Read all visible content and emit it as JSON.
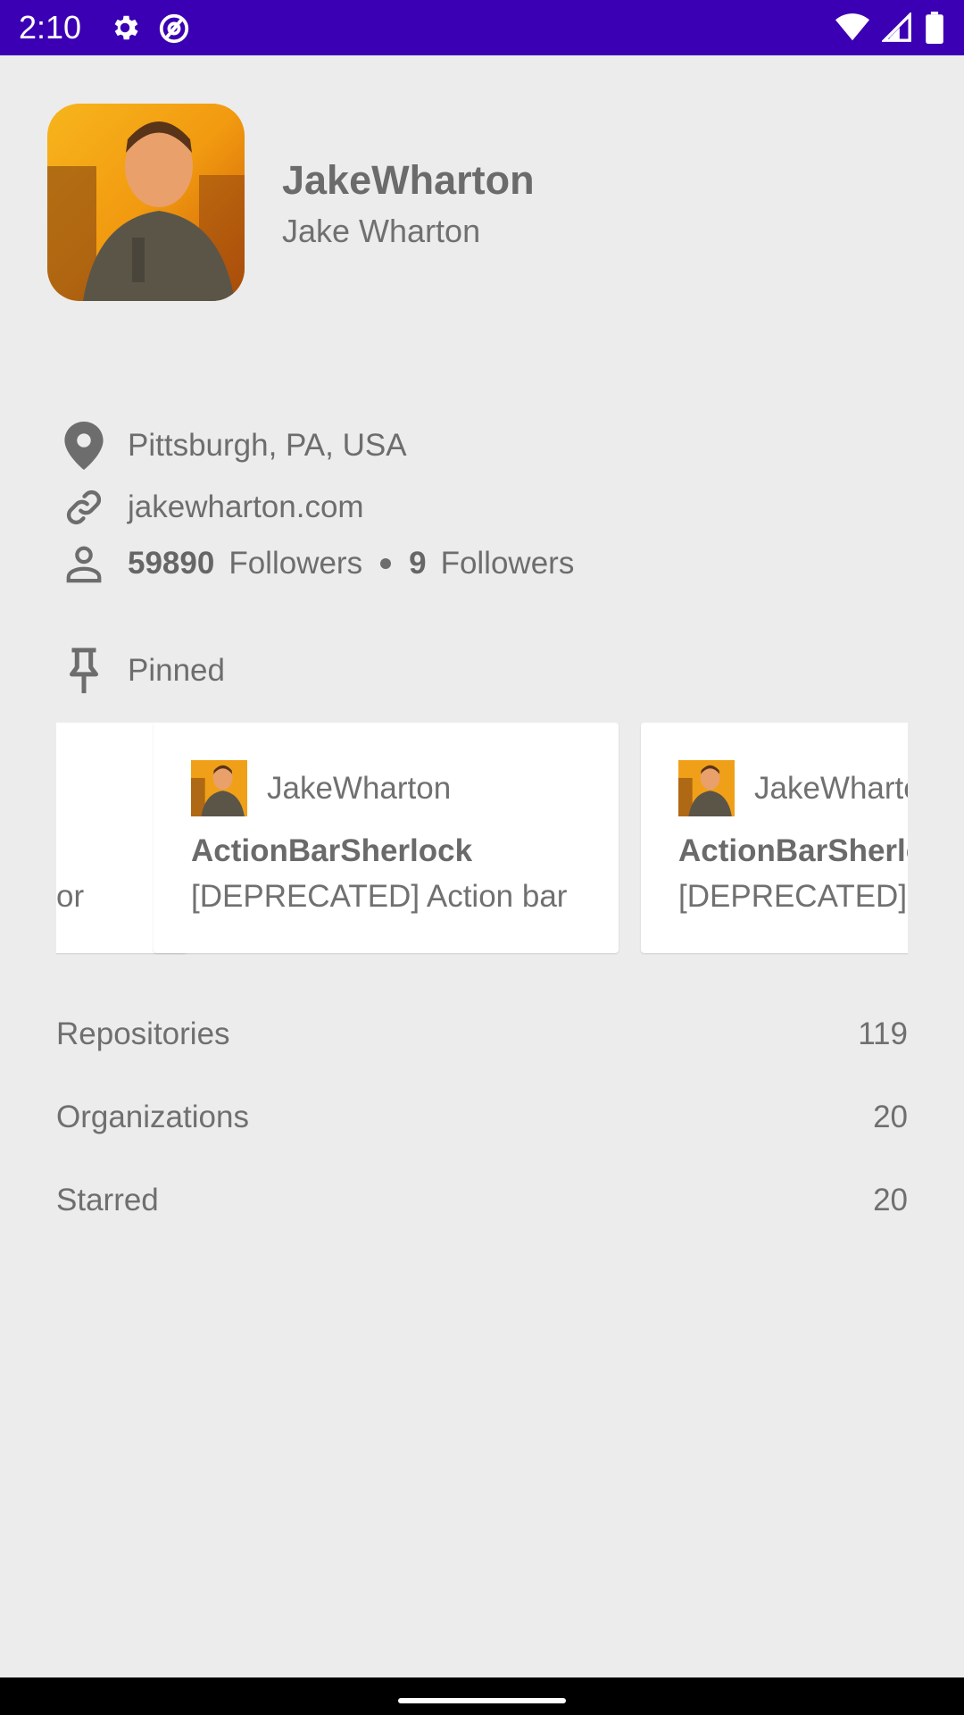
{
  "status_bar": {
    "time": "2:10",
    "background": "#3c00b4",
    "icons_left": [
      "settings-icon",
      "at-sign-icon"
    ],
    "icons_right": [
      "wifi-icon",
      "cellular-signal-icon",
      "battery-icon"
    ]
  },
  "profile": {
    "username": "JakeWharton",
    "full_name": "Jake Wharton",
    "avatar": "profile-photo"
  },
  "info": {
    "location": "Pittsburgh, PA, USA",
    "website": "jakewharton.com",
    "followers_count": "59890",
    "followers_label": "Followers",
    "following_count": "9",
    "following_label": "Followers"
  },
  "pinned": {
    "label": "Pinned",
    "partial_text": "or",
    "cards": [
      {
        "owner": "JakeWharton",
        "title": "ActionBarSherlock",
        "description": "[DEPRECATED] Action bar"
      },
      {
        "owner": "JakeWharton",
        "title": "ActionBarSherlock",
        "description": "[DEPRECATED] Action bar"
      }
    ]
  },
  "stats": [
    {
      "label": "Repositories",
      "value": "119"
    },
    {
      "label": "Organizations",
      "value": "20"
    },
    {
      "label": "Starred",
      "value": "20"
    }
  ]
}
